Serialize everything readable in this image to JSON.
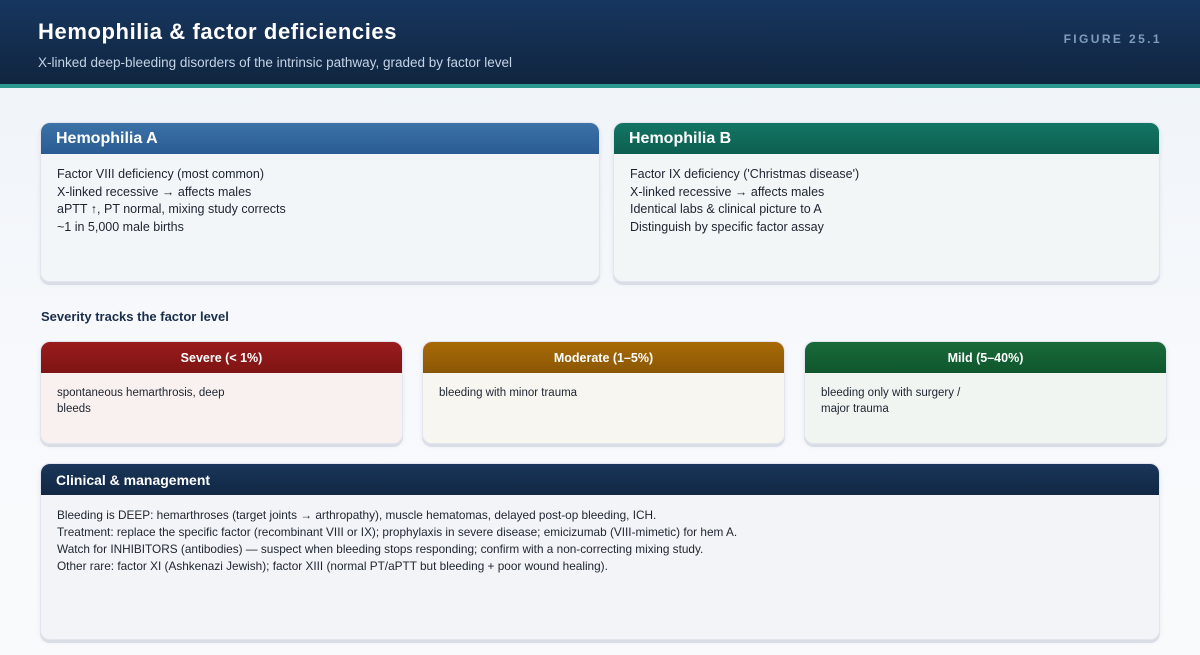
{
  "header": {
    "title": "Hemophilia & factor deficiencies",
    "subtitle": "X-linked deep-bleeding disorders of the intrinsic pathway, graded by factor level",
    "figure_label": "FIGURE 25.1"
  },
  "hemophilia_a": {
    "title": "Hemophilia A",
    "lines": [
      "Factor VIII deficiency (most common)",
      "X-linked recessive → affects males",
      "aPTT ↑, PT normal, mixing study corrects",
      "~1 in 5,000 male births"
    ]
  },
  "hemophilia_b": {
    "title": "Hemophilia B",
    "lines": [
      "Factor IX deficiency ('Christmas disease')",
      "X-linked recessive → affects males",
      "Identical labs & clinical picture to A",
      "Distinguish by specific factor assay"
    ]
  },
  "severity": {
    "section_title": "Severity tracks the factor level",
    "levels": [
      {
        "title": "Severe (< 1%)",
        "lines": [
          "spontaneous hemarthrosis, deep",
          "bleeds"
        ]
      },
      {
        "title": "Moderate (1–5%)",
        "lines": [
          "bleeding with minor trauma"
        ]
      },
      {
        "title": "Mild (5–40%)",
        "lines": [
          "bleeding only with surgery /",
          "major trauma"
        ]
      }
    ]
  },
  "clinical": {
    "title": "Clinical & management",
    "lines": [
      "Bleeding is DEEP: hemarthroses (target joints → arthropathy), muscle hematomas, delayed post-op bleeding, ICH.",
      "Treatment: replace the specific factor (recombinant VIII or IX); prophylaxis in severe disease; emicizumab (VIII-mimetic) for hem A.",
      "Watch for INHIBITORS (antibodies) — suspect when bleeding stops responding; confirm with a non-correcting mixing study.",
      "Other rare: factor XI (Ashkenazi Jewish); factor XIII (normal PT/aPTT but bleeding + poor wound healing)."
    ]
  },
  "colors": {
    "header_bg": "#10253f",
    "accent_stripe": "#2a9a8e",
    "hem_a": "#295c92",
    "hem_b": "#0d5f50",
    "severe": "#8b1818",
    "moderate": "#9a5f05",
    "mild": "#145f33",
    "clinical": "#132b4b"
  }
}
